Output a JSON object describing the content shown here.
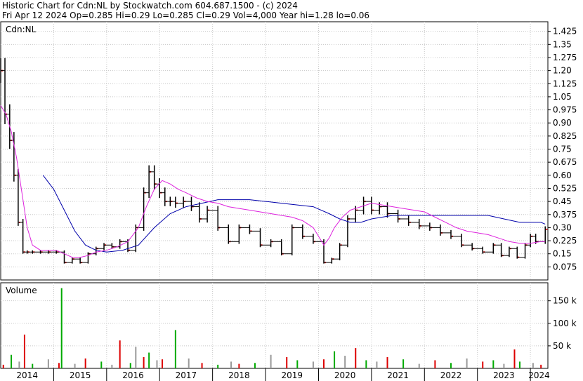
{
  "header": {
    "line1": "Historic Chart for Cdn:NL by Stockwatch.com 604.687.1500 - (c) 2024",
    "line2": "Fri Apr 12 2024   Op=0.285  Hi=0.29  Lo=0.285  Cl=0.29  Vol=4,000  Year hi=1.28  lo=0.06"
  },
  "price_panel": {
    "symbol": "Cdn:NL"
  },
  "volume_panel": {
    "title": "Volume"
  },
  "colors": {
    "background": "#ffffff",
    "grid": "#c8c8c8",
    "price_bar": "#000000",
    "close_dot": "#ff0000",
    "ma_long": "#0000aa",
    "ma_short": "#dd22dd",
    "vol_up": "#00aa00",
    "vol_down": "#dd0000",
    "vol_flat": "#999999"
  },
  "chart_data": {
    "type": "line",
    "x_axis": {
      "labels": [
        "2014",
        "2015",
        "2016",
        "2017",
        "2018",
        "2019",
        "2020",
        "2021",
        "2022",
        "2023",
        "2024"
      ],
      "range": [
        "2014-01",
        "2024-04"
      ]
    },
    "price_axis": {
      "ticks": [
        "1.425",
        "1.35",
        "1.275",
        "1.20",
        "1.125",
        "1.05",
        "0.975",
        "0.90",
        "0.825",
        "0.75",
        "0.675",
        "0.60",
        "0.525",
        "0.45",
        "0.375",
        "0.30",
        "0.225",
        "0.15",
        "0.075"
      ],
      "ylim": [
        0.0,
        1.48
      ]
    },
    "volume_axis": {
      "ticks": [
        "150 k",
        "100 k",
        "50 k"
      ],
      "ylim": [
        0,
        190000
      ]
    },
    "price_series": {
      "x": [
        2014.0,
        2014.08,
        2014.17,
        2014.25,
        2014.33,
        2014.42,
        2014.5,
        2014.6,
        2014.75,
        2014.9,
        2015.05,
        2015.2,
        2015.35,
        2015.5,
        2015.65,
        2015.8,
        2015.95,
        2016.1,
        2016.25,
        2016.4,
        2016.55,
        2016.7,
        2016.8,
        2016.9,
        2017.0,
        2017.1,
        2017.2,
        2017.3,
        2017.45,
        2017.6,
        2017.75,
        2017.9,
        2018.1,
        2018.3,
        2018.5,
        2018.7,
        2018.9,
        2019.1,
        2019.3,
        2019.5,
        2019.7,
        2019.9,
        2020.1,
        2020.25,
        2020.4,
        2020.55,
        2020.7,
        2020.85,
        2021.0,
        2021.15,
        2021.3,
        2021.5,
        2021.7,
        2021.9,
        2022.1,
        2022.3,
        2022.5,
        2022.7,
        2022.9,
        2023.1,
        2023.3,
        2023.45,
        2023.6,
        2023.75,
        2023.9,
        2024.0,
        2024.1,
        2024.28
      ],
      "close": [
        1.2,
        0.95,
        0.8,
        0.6,
        0.33,
        0.16,
        0.16,
        0.16,
        0.16,
        0.16,
        0.16,
        0.1,
        0.12,
        0.1,
        0.15,
        0.18,
        0.2,
        0.19,
        0.22,
        0.17,
        0.3,
        0.5,
        0.62,
        0.55,
        0.5,
        0.45,
        0.45,
        0.44,
        0.45,
        0.42,
        0.35,
        0.4,
        0.3,
        0.22,
        0.3,
        0.28,
        0.2,
        0.22,
        0.15,
        0.3,
        0.25,
        0.22,
        0.1,
        0.12,
        0.2,
        0.35,
        0.4,
        0.45,
        0.4,
        0.42,
        0.38,
        0.35,
        0.33,
        0.31,
        0.3,
        0.27,
        0.25,
        0.2,
        0.18,
        0.16,
        0.2,
        0.14,
        0.18,
        0.13,
        0.2,
        0.25,
        0.22,
        0.29
      ]
    },
    "series": [
      {
        "values_x": [
          2014.8,
          2015.0,
          2015.2,
          2015.4,
          2015.6,
          2015.8,
          2016.0,
          2016.3,
          2016.6,
          2016.9,
          2017.2,
          2017.5,
          2017.8,
          2018.1,
          2018.4,
          2018.7,
          2019.0,
          2019.3,
          2019.6,
          2019.9,
          2020.2,
          2020.4,
          2020.6,
          2020.8,
          2021.0,
          2021.2,
          2021.4,
          2021.6,
          2021.8,
          2022.0,
          2022.3,
          2022.6,
          2022.9,
          2023.2,
          2023.5,
          2023.8,
          2024.0,
          2024.2,
          2024.28
        ],
        "values": [
          0.6,
          0.52,
          0.4,
          0.28,
          0.2,
          0.17,
          0.16,
          0.17,
          0.2,
          0.3,
          0.38,
          0.42,
          0.44,
          0.46,
          0.46,
          0.46,
          0.45,
          0.44,
          0.43,
          0.42,
          0.38,
          0.35,
          0.33,
          0.33,
          0.35,
          0.36,
          0.37,
          0.37,
          0.37,
          0.37,
          0.37,
          0.37,
          0.37,
          0.37,
          0.35,
          0.33,
          0.33,
          0.33,
          0.32
        ]
      },
      {
        "values_x": [
          2014.0,
          2014.1,
          2014.2,
          2014.3,
          2014.4,
          2014.5,
          2014.6,
          2014.75,
          2014.9,
          2015.05,
          2015.2,
          2015.35,
          2015.5,
          2015.65,
          2015.8,
          2016.0,
          2016.2,
          2016.4,
          2016.6,
          2016.75,
          2016.9,
          2017.05,
          2017.2,
          2017.35,
          2017.5,
          2017.7,
          2017.9,
          2018.1,
          2018.3,
          2018.5,
          2018.7,
          2018.9,
          2019.1,
          2019.3,
          2019.5,
          2019.7,
          2019.9,
          2020.0,
          2020.1,
          2020.2,
          2020.3,
          2020.45,
          2020.6,
          2020.8,
          2021.0,
          2021.2,
          2021.4,
          2021.6,
          2021.8,
          2022.0,
          2022.2,
          2022.4,
          2022.6,
          2022.8,
          2023.0,
          2023.2,
          2023.4,
          2023.6,
          2023.8,
          2024.0,
          2024.2,
          2024.28
        ],
        "values": [
          1.0,
          0.95,
          0.85,
          0.7,
          0.5,
          0.3,
          0.2,
          0.17,
          0.17,
          0.17,
          0.15,
          0.13,
          0.13,
          0.14,
          0.16,
          0.17,
          0.19,
          0.22,
          0.3,
          0.42,
          0.52,
          0.57,
          0.55,
          0.52,
          0.5,
          0.47,
          0.45,
          0.44,
          0.42,
          0.41,
          0.4,
          0.39,
          0.38,
          0.37,
          0.36,
          0.34,
          0.3,
          0.25,
          0.2,
          0.24,
          0.3,
          0.36,
          0.4,
          0.42,
          0.44,
          0.43,
          0.42,
          0.41,
          0.4,
          0.39,
          0.36,
          0.33,
          0.3,
          0.28,
          0.27,
          0.26,
          0.24,
          0.22,
          0.21,
          0.21,
          0.22,
          0.22
        ]
      }
    ],
    "volume_series": {
      "x": [
        2014.05,
        2014.2,
        2014.35,
        2014.45,
        2014.6,
        2014.9,
        2015.1,
        2015.15,
        2015.4,
        2015.6,
        2015.9,
        2016.1,
        2016.25,
        2016.45,
        2016.55,
        2016.7,
        2016.8,
        2016.95,
        2017.05,
        2017.3,
        2017.55,
        2017.8,
        2018.1,
        2018.35,
        2018.5,
        2018.8,
        2019.1,
        2019.4,
        2019.6,
        2019.9,
        2020.1,
        2020.3,
        2020.5,
        2020.7,
        2020.9,
        2021.1,
        2021.3,
        2021.6,
        2021.9,
        2022.2,
        2022.5,
        2022.8,
        2023.1,
        2023.3,
        2023.5,
        2023.7,
        2023.8,
        2024.05,
        2024.2
      ],
      "values": [
        8000,
        30000,
        15000,
        75000,
        10000,
        20000,
        12000,
        178000,
        10000,
        22000,
        15000,
        8000,
        62000,
        12000,
        48000,
        25000,
        35000,
        18000,
        20000,
        85000,
        22000,
        12000,
        8000,
        15000,
        10000,
        12000,
        30000,
        25000,
        18000,
        15000,
        20000,
        38000,
        28000,
        45000,
        18000,
        15000,
        25000,
        20000,
        10000,
        18000,
        12000,
        22000,
        15000,
        18000,
        10000,
        42000,
        15000,
        12000,
        8000
      ]
    }
  }
}
